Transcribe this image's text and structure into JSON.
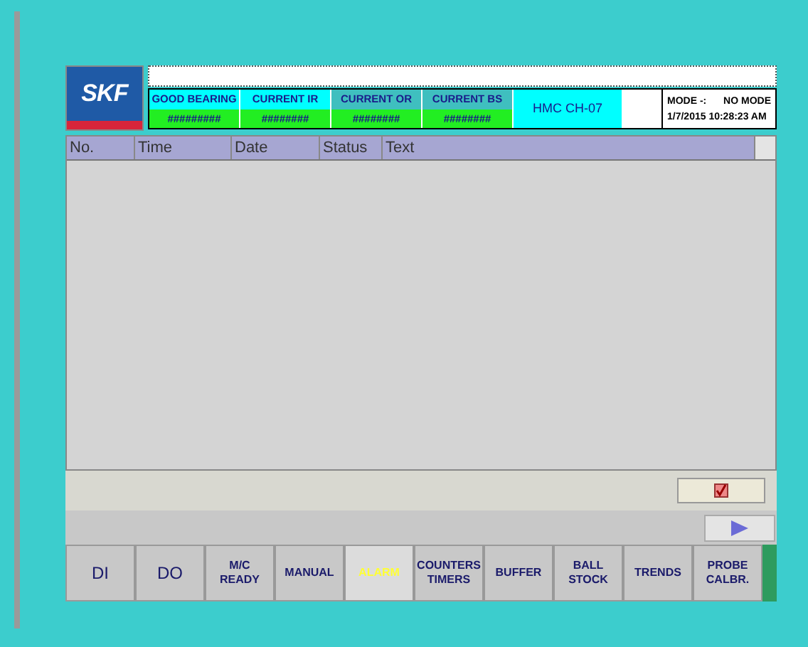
{
  "logo": "SKF",
  "indicators": [
    {
      "label": "GOOD BEARING",
      "value": "#########",
      "color": "#00ffff"
    },
    {
      "label": "CURRENT IR",
      "value": "########",
      "color": "#00ffff"
    },
    {
      "label": "CURRENT OR",
      "value": "########",
      "color": "#3fbfbf"
    },
    {
      "label": "CURRENT BS",
      "value": "########",
      "color": "#3fbfbf"
    }
  ],
  "machine": "HMC CH-07",
  "mode": {
    "label": "MODE -:",
    "value": "NO MODE",
    "datetime": "1/7/2015 10:28:23 AM"
  },
  "table": {
    "columns": [
      "No.",
      "Time",
      "Date",
      "Status",
      "Text"
    ]
  },
  "tabs": [
    {
      "label": "DI",
      "selected": false
    },
    {
      "label": "DO",
      "selected": false
    },
    {
      "label": "M/C\nREADY",
      "selected": false
    },
    {
      "label": "MANUAL",
      "selected": false
    },
    {
      "label": "ALARM",
      "selected": true
    },
    {
      "label": "COUNTERS\nTIMERS",
      "selected": false
    },
    {
      "label": "BUFFER",
      "selected": false
    },
    {
      "label": "BALL\nSTOCK",
      "selected": false
    },
    {
      "label": "TRENDS",
      "selected": false
    },
    {
      "label": "PROBE\nCALBR.",
      "selected": false
    }
  ]
}
